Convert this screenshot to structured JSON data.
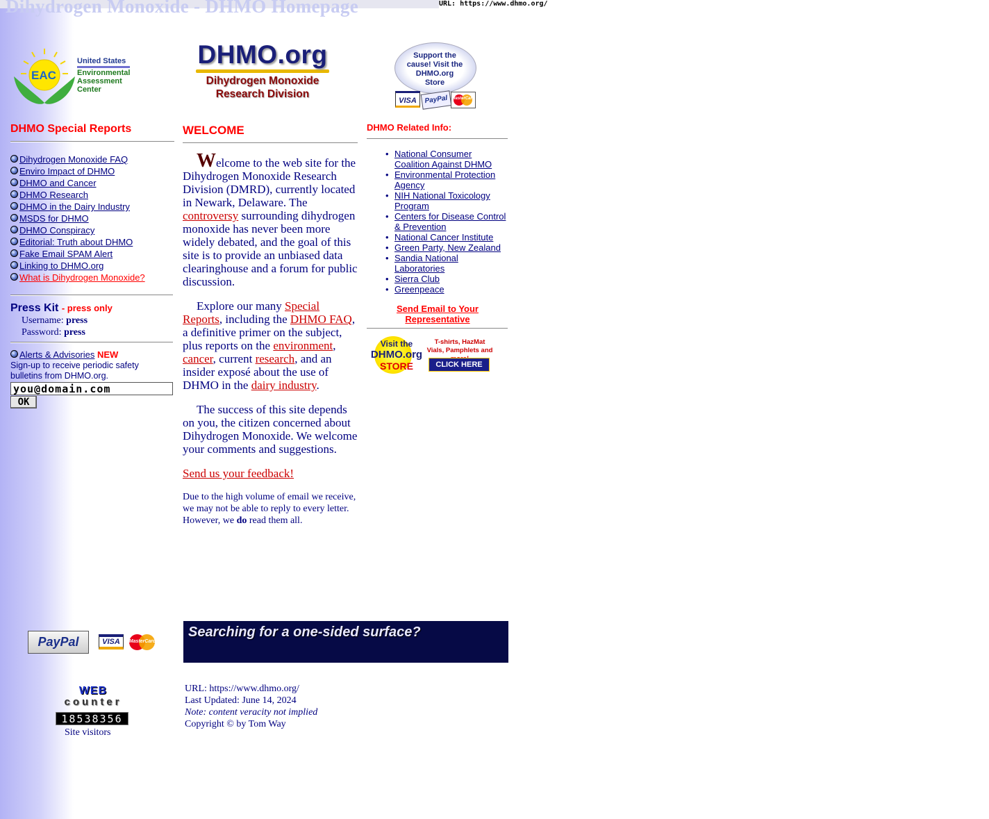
{
  "page_title": "Dihydrogen Monoxide - DHMO Homepage",
  "url_strip": "URL: https://www.dhmo.org/",
  "logos": {
    "eac_abbr": "EAC",
    "eac_lines": [
      "United States",
      "Environmental",
      "Assessment",
      "Center"
    ],
    "dhmo_main": "DHMO.org",
    "dhmo_sub1": "Dihydrogen Monoxide",
    "dhmo_sub2": "Research Division",
    "store_lines": [
      "Support the",
      "cause! Visit the",
      "DHMO.org",
      "Store"
    ],
    "card_visa": "VISA",
    "card_paypal": "PayPal",
    "card_mc": "MasterCard"
  },
  "left": {
    "special_reports_title": "DHMO Special Reports",
    "reports": [
      "Dihydrogen Monoxide FAQ",
      "Enviro Impact of DHMO",
      "DHMO and Cancer",
      "DHMO Research",
      "DHMO in the Dairy Industry",
      "MSDS for DHMO",
      "DHMO Conspiracy",
      "Editorial: Truth about DHMO",
      "Fake Email SPAM Alert",
      "Linking to DHMO.org",
      "What is Dihydrogen Monoxide?"
    ],
    "press_kit_title": "Press Kit",
    "press_only": "- press only",
    "username_label": "Username:",
    "username_value": "press",
    "password_label": "Password:",
    "password_value": "press",
    "alerts_link": "Alerts & Advisories",
    "new_badge": "NEW",
    "signup_text": "Sign-up to receive periodic safety bulletins from DHMO.org.",
    "email_value": "you@domain.com",
    "ok_label": "OK",
    "pay_paypal": "PayPal",
    "pay_visa": "VISA",
    "pay_mc": "MasterCard",
    "counter_web": "WEB",
    "counter_word": "counter",
    "counter_digits": "18538356",
    "site_visitors": "Site visitors"
  },
  "center": {
    "welcome_title": "WELCOME",
    "drop_cap": "W",
    "p1_a": "elcome to the web site for the Dihydrogen Monoxide Research Division (DMRD), currently located in Newark, Delaware. The ",
    "p1_link": "controversy",
    "p1_b": " surrounding dihydrogen monoxide has never been more widely debated, and the goal of this site is to provide an unbiased data clearinghouse and a forum for public discussion.",
    "p2_a": "Explore our many ",
    "p2_link1": "Special Reports",
    "p2_b": ", including the ",
    "p2_link2": "DHMO FAQ",
    "p2_c": ", a definitive primer on the subject, plus reports on the ",
    "p2_link3": "environment",
    "p2_d": ", ",
    "p2_link4": "cancer",
    "p2_e": ", current ",
    "p2_link5": "research",
    "p2_f": ", and an insider exposé about the use of DHMO in the ",
    "p2_link6": "dairy industry",
    "p2_g": ".",
    "p3": "The success of this site depends on you, the citizen concerned about Dihydrogen Monoxide. We welcome your comments and suggestions.",
    "feedback_link": "Send us your feedback!",
    "p4_a": "Due to the high volume of email we receive, we may not be able to reply to every letter. However, we ",
    "p4_bold": "do",
    "p4_b": " read them all.",
    "banner_text": "Searching for a one-sided surface?",
    "footer_url": "URL: https://www.dhmo.org/",
    "footer_updated": "Last Updated: June 14, 2024",
    "footer_note": "Note: content veracity not implied",
    "footer_copyright": "Copyright © by Tom Way"
  },
  "right": {
    "related_title": "DHMO Related Info:",
    "links": [
      "National Consumer Coalition Against DHMO",
      "Environmental Protection Agency",
      "NIH National Toxicology Program",
      "Centers for Disease Control & Prevention",
      "National Cancer Institute",
      "Green Party, New Zealand",
      "Sandia National Laboratories",
      "Sierra Club",
      "Greenpeace"
    ],
    "email_rep": "Send Email to Your Representative",
    "store_visit": "Visit the",
    "store_name": "DHMO.org",
    "store_word": "STORE",
    "store_promo": "T-shirts, HazMat Vials, Pamphlets and more!",
    "click_here": "CLICK HERE"
  }
}
